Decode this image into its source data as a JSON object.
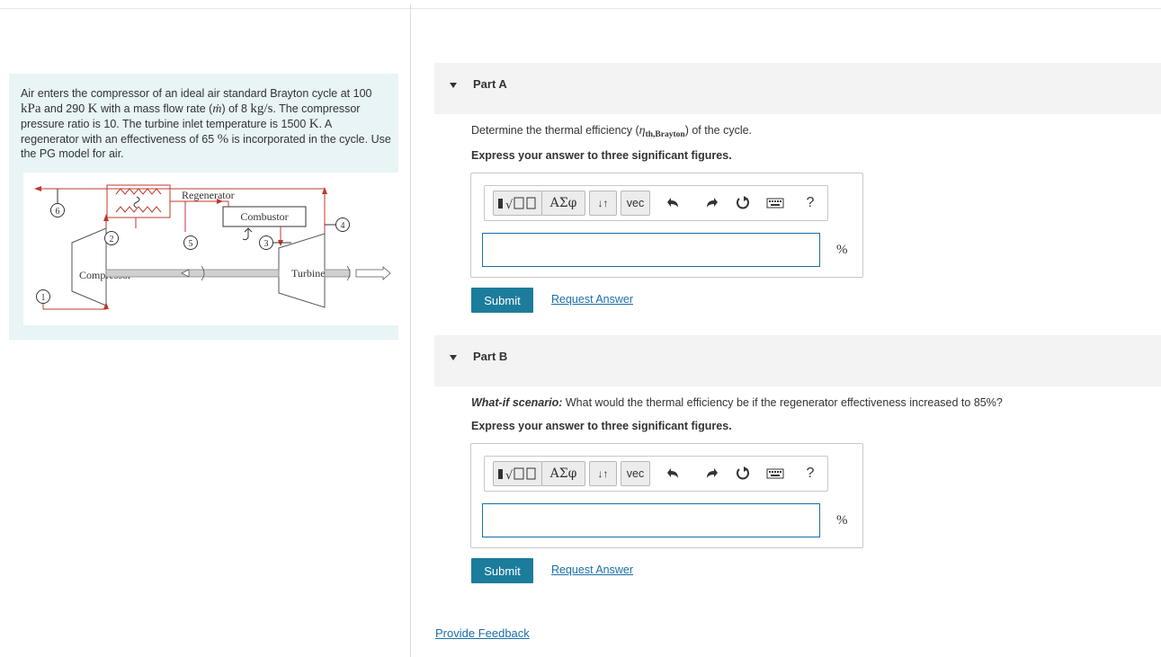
{
  "problem": {
    "text_1": "Air enters the compressor of an ideal air standard Brayton cycle at 100 ",
    "unit_kpa": "kPa",
    "text_2": " and 290 ",
    "unit_k": "K",
    "text_3": " with a mass flow rate (",
    "mdot": "ṁ",
    "text_4": ") of 8 ",
    "unit_kgs": "kg/s",
    "text_5": ". The compressor pressure ratio is 10. The turbine inlet temperature is 1500 ",
    "unit_k2": "K",
    "text_6": ". A regenerator with an effectiveness of 65 ",
    "unit_pct": "%",
    "text_7": " is incorporated in the cycle. Use the PG model for air."
  },
  "figure": {
    "regenerator": "Regenerator",
    "combustor": "Combustor",
    "compressor": "Compressor",
    "turbine": "Turbine",
    "states": [
      "1",
      "2",
      "3",
      "4",
      "5",
      "6"
    ]
  },
  "part_a": {
    "title": "Part A",
    "prompt_pre": "Determine the thermal efficiency (",
    "eta": "η",
    "eta_sub": "th,Brayton",
    "prompt_post": ") of the cycle.",
    "instruction": "Express your answer to three significant figures.",
    "unit": "%",
    "input_value": "",
    "submit": "Submit",
    "request": "Request Answer"
  },
  "part_b": {
    "title": "Part B",
    "prompt_bold": "What-if scenario:",
    "prompt_rest": " What would the thermal efficiency be if the regenerator effectiveness increased to 85%?",
    "instruction": "Express your answer to three significant figures.",
    "unit": "%",
    "input_value": "",
    "submit": "Submit",
    "request": "Request Answer"
  },
  "toolbar": {
    "greek": "ΑΣφ",
    "sort": "↓↑",
    "vec": "vec",
    "help": "?",
    "icons": [
      "templates-icon",
      "undo-icon",
      "redo-icon",
      "reset-icon",
      "keyboard-icon",
      "help-icon"
    ]
  },
  "footer": {
    "feedback": "Provide Feedback"
  },
  "colors": {
    "accent": "#1c7c9c",
    "link": "#1a6fa8",
    "diagram_red": "#c0392b",
    "problem_bg": "#e8f4f6"
  }
}
